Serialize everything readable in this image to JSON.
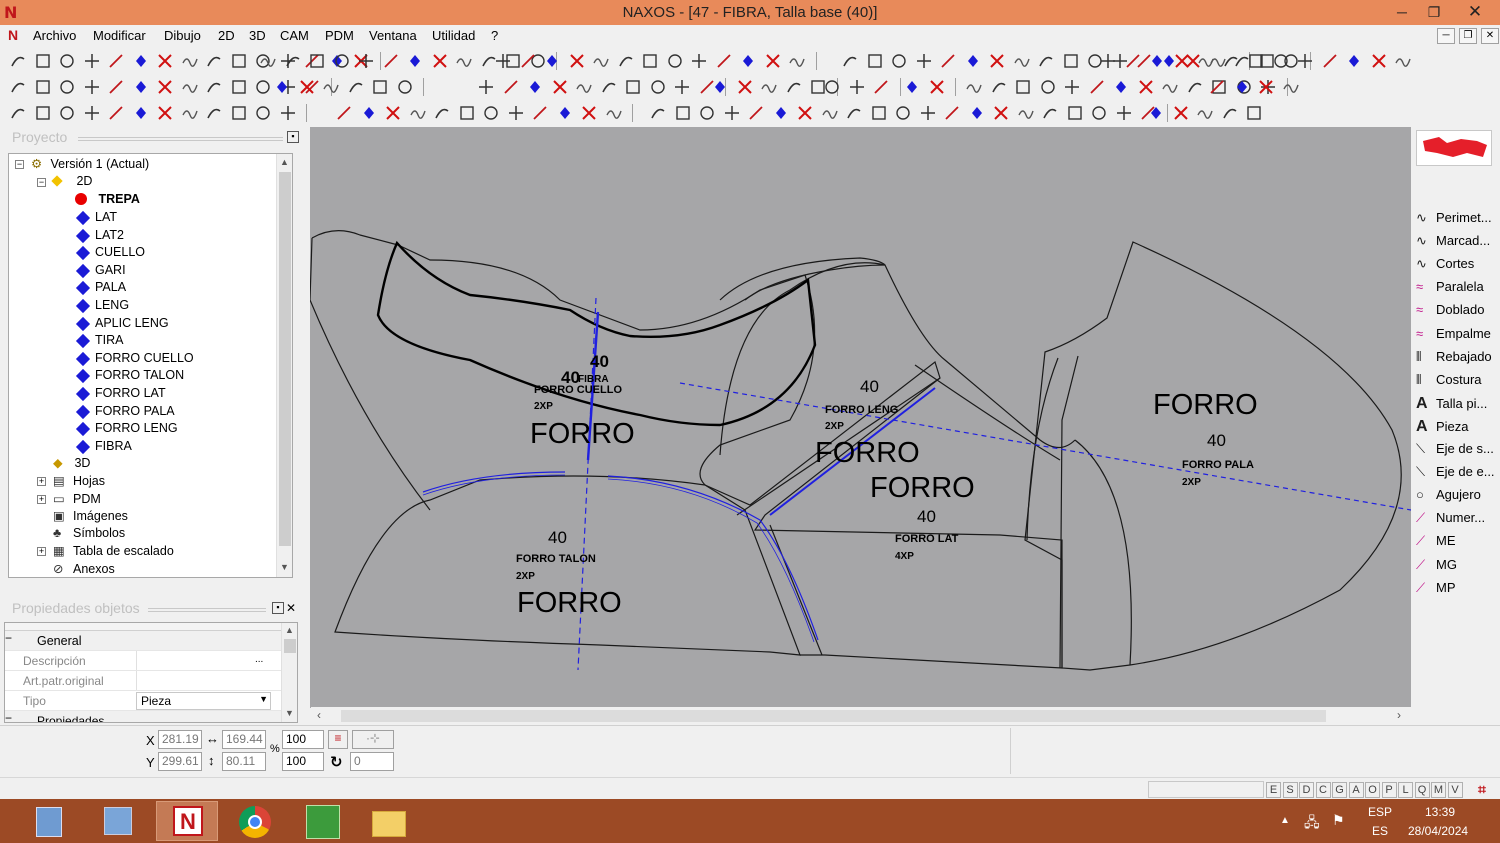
{
  "window": {
    "title": "NAXOS - [47 - FIBRA, Talla base (40)]",
    "minimize_glyph": "─",
    "restore_glyph": "❐",
    "close_glyph": "✕"
  },
  "menu": {
    "items": [
      "Archivo",
      "Modificar",
      "Dibujo",
      "2D",
      "3D",
      "CAM",
      "PDM",
      "Ventana",
      "Utilidad",
      "?"
    ]
  },
  "project_panel": {
    "title": "Proyecto",
    "version": "Versión 1 (Actual)",
    "node_2d": "2D",
    "active_piece": "TREPA",
    "pieces": [
      "LAT",
      "LAT2",
      "CUELLO",
      "GARI",
      "PALA",
      "LENG",
      "APLIC LENG",
      "TIRA",
      "FORRO CUELLO",
      "FORRO TALON",
      "FORRO LAT",
      "FORRO PALA",
      "FORRO LENG",
      "FIBRA"
    ],
    "node_3d": "3D",
    "other_nodes": [
      "Hojas",
      "PDM",
      "Imágenes",
      "Símbolos",
      "Tabla de escalado",
      "Anexos"
    ]
  },
  "properties_panel": {
    "title": "Propiedades objetos",
    "group_general": "General",
    "rows": [
      {
        "label": "Descripción",
        "value": ""
      },
      {
        "label": "Art.patr.original",
        "value": ""
      },
      {
        "label": "Tipo",
        "value": "Pieza"
      }
    ],
    "group_properties": "Propiedades"
  },
  "canvas": {
    "labels": {
      "cuello_size": "40",
      "cuello_size2": "40",
      "cuello_fibra": "FIBRA",
      "cuello_name": "FORRO CUELLO",
      "cuello_qty": "2XP",
      "cuello_forro": "FORRO",
      "talon_size": "40",
      "talon_name": "FORRO TALON",
      "talon_qty": "2XP",
      "talon_forro": "FORRO",
      "leng_size": "40",
      "leng_name": "FORRO LENG",
      "leng_qty": "2XP",
      "leng_forro": "FORRO",
      "lat_forro": "FORRO",
      "lat_size": "40",
      "lat_name": "FORRO LAT",
      "lat_qty": "4XP",
      "pala_forro": "FORRO",
      "pala_size": "40",
      "pala_name": "FORRO PALA",
      "pala_qty": "2XP"
    }
  },
  "palette": {
    "items": [
      {
        "label": "Perimet...",
        "icon": "curve-icon"
      },
      {
        "label": "Marcad...",
        "icon": "curve-icon"
      },
      {
        "label": "Cortes",
        "icon": "curve-icon"
      },
      {
        "label": "Paralela",
        "icon": "parallel-icon"
      },
      {
        "label": "Doblado",
        "icon": "parallel-icon"
      },
      {
        "label": "Empalme",
        "icon": "parallel-icon"
      },
      {
        "label": "Rebajado",
        "icon": "rebajado-icon"
      },
      {
        "label": "Costura",
        "icon": "rebajado-icon"
      },
      {
        "label": "Talla pi...",
        "icon": "text-icon"
      },
      {
        "label": "Pieza",
        "icon": "text-icon"
      },
      {
        "label": "Eje de s...",
        "icon": "axis-icon"
      },
      {
        "label": "Eje de e...",
        "icon": "axis-icon"
      },
      {
        "label": "Agujero",
        "icon": "hole-icon"
      },
      {
        "label": "Numer...",
        "icon": "marker-icon"
      },
      {
        "label": "ME",
        "icon": "marker-icon"
      },
      {
        "label": "MG",
        "icon": "marker-icon"
      },
      {
        "label": "MP",
        "icon": "marker-icon"
      }
    ]
  },
  "coords": {
    "x_label": "X",
    "y_label": "Y",
    "x": "281.19",
    "y": "299.61",
    "width": "169.44",
    "height": "80.11",
    "percent_sign": "%",
    "scale_x": "100",
    "scale_y": "100",
    "rotation": "0"
  },
  "statusbar": {
    "letters": [
      "E",
      "S",
      "D",
      "C",
      "G",
      "A",
      "O",
      "P",
      "L",
      "Q",
      "M",
      "V"
    ]
  },
  "taskbar": {
    "lang_line1": "ESP",
    "lang_line2": "ES",
    "time": "13:39",
    "date": "28/04/2024"
  },
  "colors": {
    "title_bar": "#e88a5a",
    "canvas_bg": "#a6a6a8",
    "taskbar": "#9c4a25",
    "selection_blue": "#1a1ad6",
    "axis_blue": "#2020e0"
  }
}
